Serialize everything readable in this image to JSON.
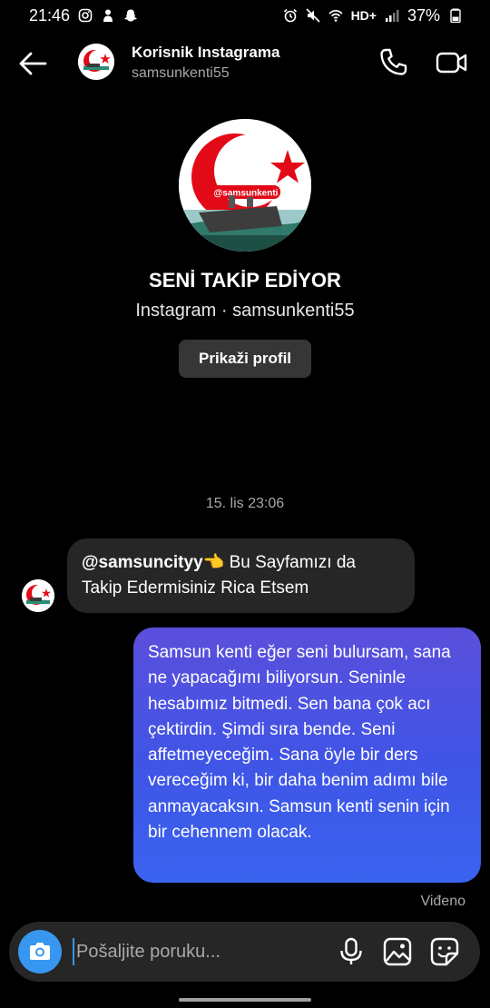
{
  "status_bar": {
    "time": "21:46",
    "network": "HD+",
    "battery": "37%"
  },
  "header": {
    "name": "Korisnik Instagrama",
    "username": "samsunkenti55"
  },
  "profile": {
    "headline": "SENİ TAKİP EDİYOR",
    "subline": "Instagram · samsunkenti55",
    "view_profile_label": "Prikaži profil",
    "avatar_text": "@samsunkenti"
  },
  "conversation": {
    "timestamp": "15. lis 23:06",
    "received": {
      "mention": "@samsuncityy",
      "emoji": "👈",
      "text": " Bu Sayfamızı da Takip Edermisiniz Rica Etsem"
    },
    "sent": {
      "text": "Samsun kenti eğer seni bulursam, sana ne yapacağımı biliyorsun. Seninle hesabımız bitmedi. Sen bana çok acı çektirdin. Şimdi sıra bende. Seni affetmeyeceğim. Sana öyle bir ders vereceğim ki, bir daha benim adımı bile anmayacaksın. Samsun kenti senin için bir cehennem olacak."
    },
    "seen_label": "Viđeno"
  },
  "composer": {
    "placeholder": "Pošaljite poruku..."
  },
  "colors": {
    "background": "#000000",
    "bubble_received": "#262626",
    "bubble_sent_top": "#5b4fdc",
    "bubble_sent_bottom": "#3a63ef",
    "accent": "#3797f0",
    "secondary_text": "#a8a8a8",
    "logo_red": "#e30a17"
  },
  "icons": {
    "back": "arrow-left-icon",
    "call": "phone-icon",
    "video": "video-camera-icon",
    "camera": "camera-icon",
    "mic": "microphone-icon",
    "gallery": "image-icon",
    "sticker": "sticker-icon"
  }
}
